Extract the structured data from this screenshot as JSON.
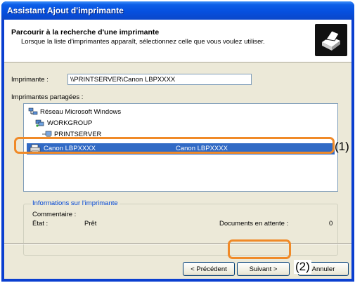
{
  "window": {
    "title": "Assistant Ajout d'imprimante"
  },
  "header": {
    "title": "Parcourir à la recherche d'une imprimante",
    "subtitle": "Lorsque la liste d'imprimantes apparaît, sélectionnez celle que vous voulez utiliser.",
    "icon": "printer-icon"
  },
  "printer_field": {
    "label": "Imprimante :",
    "value": "\\\\PRINTSERVER\\Canon LBPXXXX"
  },
  "shared": {
    "label": "Imprimantes partagées :",
    "items": [
      {
        "label": "Réseau Microsoft Windows",
        "icon": "network-icon"
      },
      {
        "label": "WORKGROUP",
        "icon": "workgroup-icon"
      },
      {
        "label": "PRINTSERVER",
        "icon": "computer-icon"
      },
      {
        "label": "Canon LBPXXXX",
        "comment": "Canon LBPXXXX",
        "icon": "printer-icon",
        "selected": true
      }
    ]
  },
  "info": {
    "title": "Informations sur l'imprimante",
    "comment_label": "Commentaire :",
    "state_label": "État :",
    "state_value": "Prêt",
    "docs_label": "Documents en attente :",
    "docs_value": "0"
  },
  "buttons": {
    "back": "< Précédent",
    "next": "Suivant >",
    "cancel": "Annuler"
  },
  "annotations": {
    "one": "(1)",
    "two": "(2)"
  },
  "colors": {
    "highlight": "#f08a28",
    "selection": "#316ac5",
    "title_bar": "#0650df"
  }
}
